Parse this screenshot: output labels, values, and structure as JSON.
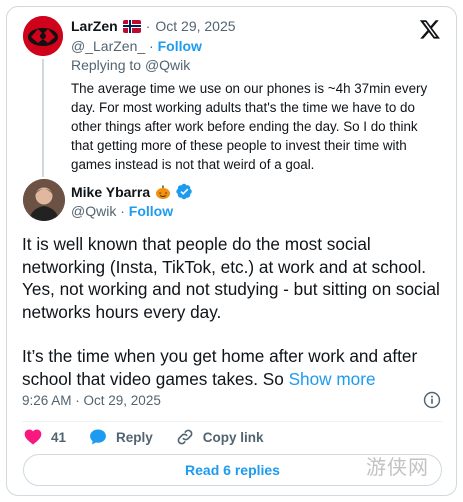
{
  "parent": {
    "name": "LarZen",
    "flag_icon": "norway-flag-icon",
    "date": "Oct 29, 2025",
    "handle": "@_LarZen_",
    "follow_label": "Follow",
    "replying_to_prefix": "Replying to",
    "replying_to_handle": "@Qwik",
    "text": "The average time we use on our phones is ~4h 37min every day.  For most working adults that's the time we have to do other things after work before ending the day. So I do think that getting more of these people to invest their time with games instead is not that weird of a goal."
  },
  "main": {
    "name": "Mike Ybarra",
    "name_emoji": "pumpkin-icon",
    "verified_icon": "verified-badge-icon",
    "handle": "@Qwik",
    "follow_label": "Follow",
    "paragraph1": "It is well known that people do the most social networking (Insta, TikTok, etc.) at work and at school. Yes, not working and not studying - but sitting on social networks hours every day.",
    "paragraph2": "It’s the time when you get home after work and after school that video games takes. So",
    "show_more": "Show more",
    "timestamp": "9:26 AM · Oct 29, 2025"
  },
  "actions": {
    "likes": "41",
    "reply_label": "Reply",
    "copy_link_label": "Copy link"
  },
  "read_replies_label": "Read 6 replies",
  "watermark": "游侠网",
  "colors": {
    "accent": "#1d9bf0",
    "like": "#f91880",
    "muted": "#536471",
    "text": "#0f1419"
  }
}
